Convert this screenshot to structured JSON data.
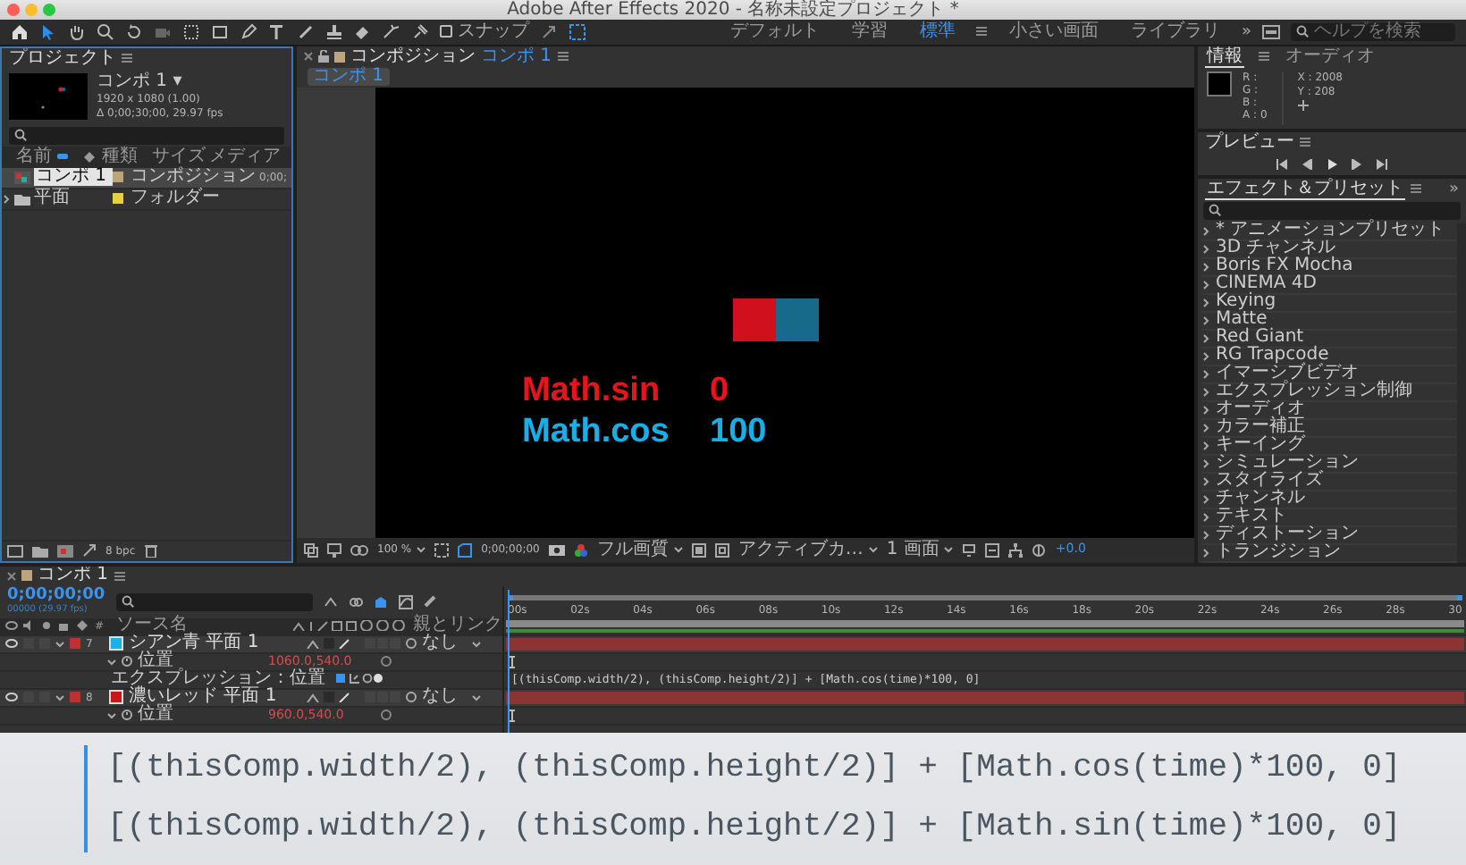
{
  "window": {
    "title": "Adobe After Effects 2020 - 名称未設定プロジェクト *"
  },
  "toolbar": {
    "snap": {
      "label": "スナップ",
      "checked": false
    }
  },
  "workspaces": [
    {
      "label": "デフォルト",
      "selected": false
    },
    {
      "label": "学習",
      "selected": false
    },
    {
      "label": "標準",
      "selected": true
    },
    {
      "label": "小さい画面",
      "selected": false
    },
    {
      "label": "ライブラリ",
      "selected": false
    }
  ],
  "workspace_overflow": "»",
  "help_search": {
    "placeholder": "ヘルプを検索"
  },
  "project": {
    "tab": "プロジェクト",
    "comp_name": "コンポ 1 ▾",
    "resolution": "1920 x 1080 (1.00)",
    "duration": "Δ 0;00;30;00, 29.97 fps",
    "columns": [
      "名前",
      "種類",
      "サイズ",
      "メディア"
    ],
    "items": [
      {
        "kind": "comp",
        "name": "コンポ 1",
        "type": "コンポジション",
        "color": "#bca47c",
        "media": "0;00;",
        "selected": true
      },
      {
        "kind": "folder",
        "name": "平面",
        "type": "フォルダー",
        "color": "#e6d23c",
        "selected": false
      }
    ],
    "bit_depth": "8 bpc"
  },
  "composition": {
    "tab": "コンポジション",
    "tab_comp": "コンポ 1",
    "subtab": "コンポ 1",
    "squares": [
      {
        "color": "#d0101c"
      },
      {
        "color": "#176a8a"
      }
    ],
    "labels": [
      {
        "name": "Math.sin",
        "value": "0",
        "color": "#e8141c"
      },
      {
        "name": "Math.cos",
        "value": "100",
        "color": "#18aee6"
      }
    ],
    "zoom": "100 %",
    "timecode": "0;00;00;00",
    "quality": "フル画質",
    "camera": "アクティブカ…",
    "views": "1 画面",
    "exposure": "+0.0"
  },
  "info": {
    "tabs": [
      {
        "label": "情報",
        "selected": true
      },
      {
        "label": "オーディオ",
        "selected": false
      }
    ],
    "channels": [
      "R :",
      "G :",
      "B :",
      "A : 0"
    ],
    "x": "X : 2008",
    "y": "Y : 208"
  },
  "preview": {
    "title": "プレビュー"
  },
  "effects": {
    "title": "エフェクト＆プリセット",
    "overflow": "»",
    "items": [
      "* アニメーションプリセット",
      "3D チャンネル",
      "Boris FX Mocha",
      "CINEMA 4D",
      "Keying",
      "Matte",
      "Red Giant",
      "RG Trapcode",
      "イマーシブビデオ",
      "エクスプレッション制御",
      "オーディオ",
      "カラー補正",
      "キーイング",
      "シミュレーション",
      "スタイライズ",
      "チャンネル",
      "テキスト",
      "ディストーション",
      "トランジション"
    ]
  },
  "timeline": {
    "tab": "コンポ 1",
    "timecode": "0;00;00;00",
    "frame_info": "00000 (29.97 fps)",
    "ruler": [
      "00s",
      "02s",
      "04s",
      "06s",
      "08s",
      "10s",
      "12s",
      "14s",
      "16s",
      "18s",
      "20s",
      "22s",
      "24s",
      "26s",
      "28s",
      "30"
    ],
    "columns": [
      "#",
      "ソース名",
      "親とリンク"
    ],
    "layers": [
      {
        "number": "7",
        "name": "シアン青 平面 1",
        "color": "#19b2e6",
        "parent": "なし",
        "expanded": true,
        "property": "位置",
        "value": "1060.0,540.0",
        "expression_label": "エクスプレッション：位置",
        "expression": "[(thisComp.width/2), (thisComp.height/2)] + [Math.cos(time)*100, 0]"
      },
      {
        "number": "8",
        "name": "濃いレッド 平面 1",
        "color": "#c81818",
        "parent": "なし",
        "expanded": true,
        "property": "位置",
        "value": "960.0,540.0"
      }
    ]
  },
  "code_overlay": {
    "lines": [
      "[(thisComp.width/2), (thisComp.height/2)] + [Math.cos(time)*100, 0]",
      "[(thisComp.width/2), (thisComp.height/2)] + [Math.sin(time)*100, 0]"
    ]
  }
}
